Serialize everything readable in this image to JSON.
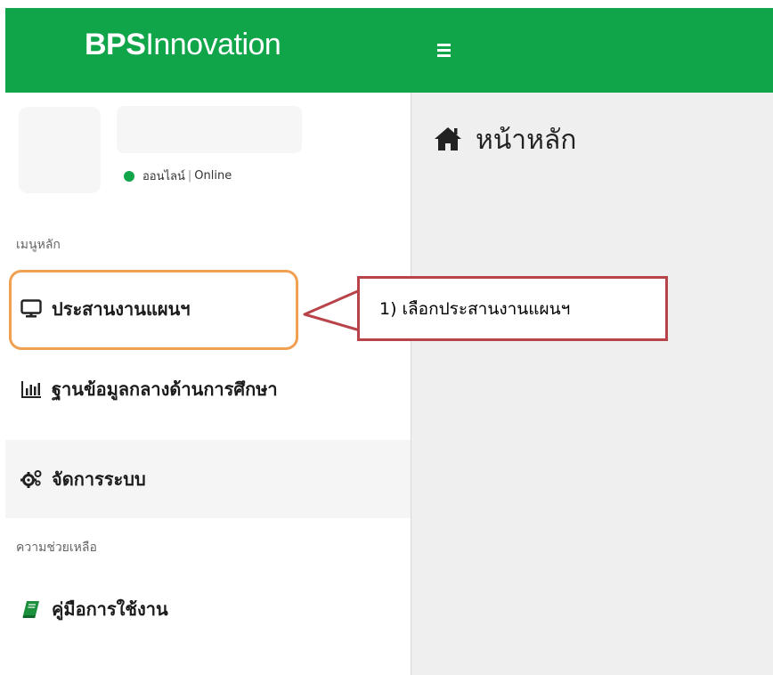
{
  "header": {
    "brand_bold": "BPS",
    "brand_rest": "Innovation",
    "menu_toggle_icon": "hamburger-icon"
  },
  "user_panel": {
    "status_thai": "ออนไลน์",
    "status_sep": "|",
    "status_en": "Online",
    "status_color": "#11a54a"
  },
  "sidebar": {
    "main_header": "เมนูหลัก",
    "items": [
      {
        "label": "ประสานงานแผนฯ",
        "icon": "monitor-icon"
      },
      {
        "label": "ฐานข้อมูลกลางด้านการศึกษา",
        "icon": "bar-chart-icon"
      },
      {
        "label": "จัดการระบบ",
        "icon": "cogs-icon"
      }
    ],
    "help_header": "ความช่วยเหลือ",
    "help_items": [
      {
        "label": "คู่มือการใช้งาน",
        "icon": "book-icon"
      }
    ]
  },
  "main": {
    "page_title": "หน้าหลัก",
    "page_icon": "home-icon"
  },
  "annotation": {
    "text": "1) เลือกประสานงานแผนฯ",
    "border_color": "#b84449",
    "highlight_color": "#f0a050"
  },
  "colors": {
    "brand_green": "#11a54a",
    "content_bg": "#efefef"
  }
}
